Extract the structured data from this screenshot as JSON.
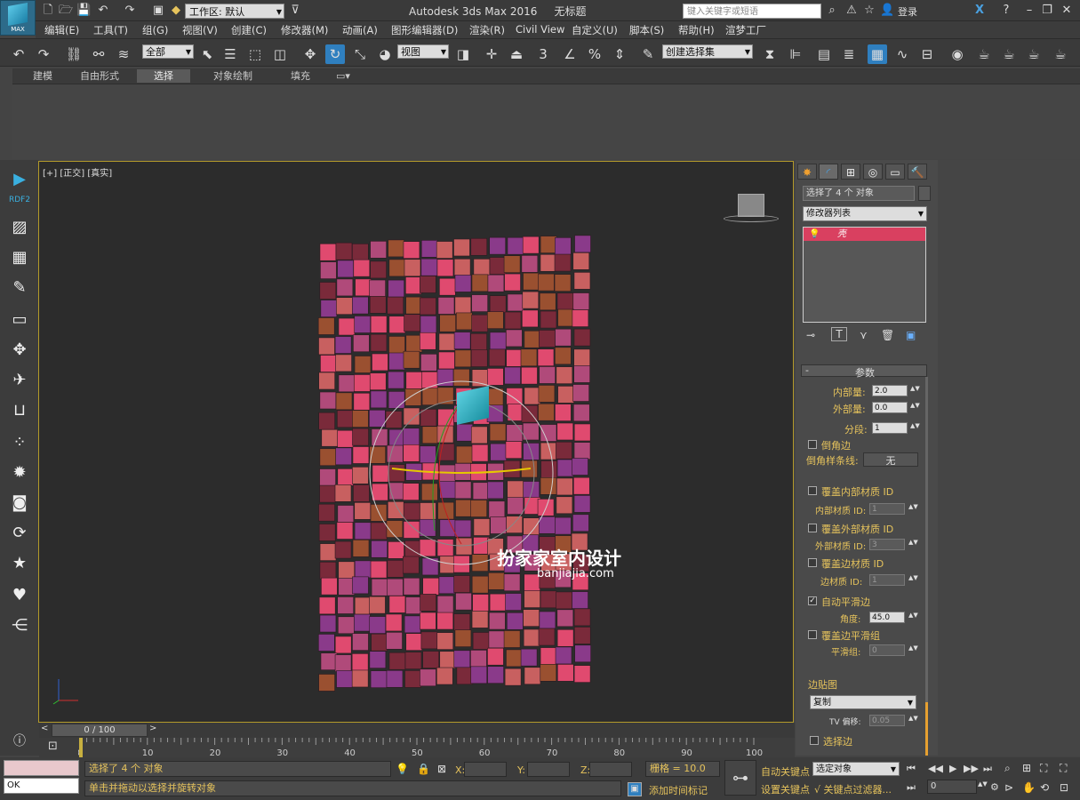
{
  "titlebar": {
    "max_label": "MAX",
    "workspace": "工作区: 默认",
    "app_title": "Autodesk 3ds Max 2016",
    "doc_title": "无标题",
    "search_placeholder": "键入关键字或短语",
    "login": "登录"
  },
  "menu": [
    "编辑(E)",
    "工具(T)",
    "组(G)",
    "视图(V)",
    "创建(C)",
    "修改器(M)",
    "动画(A)",
    "图形编辑器(D)",
    "渲染(R)",
    "Civil View",
    "自定义(U)",
    "脚本(S)",
    "帮助(H)",
    "渲梦工厂"
  ],
  "toolbar": {
    "filter": "全部",
    "refcoord": "视图",
    "selset": "创建选择集",
    "snap3": "3"
  },
  "ribbon_tabs": [
    "建模",
    "自由形式",
    "选择",
    "对象绘制",
    "填充"
  ],
  "leftbar": {
    "plugin_label": "RDF2"
  },
  "viewport": {
    "label": "[+] [正交] [真实]",
    "watermark_cn": "扮家家室内设计",
    "watermark_en": "banjiajia.com",
    "colors": [
      "#e04a6f",
      "#8a3a8a",
      "#9a5030",
      "#7a2a3a",
      "#b04a7a",
      "#c86060"
    ]
  },
  "cmdpanel": {
    "selection": "选择了 4 个 对象",
    "modlist": "修改器列表",
    "stack_item": "壳",
    "rollout": "参数",
    "inner": {
      "label": "内部量:",
      "value": "2.0"
    },
    "outer": {
      "label": "外部量:",
      "value": "0.0"
    },
    "segments": {
      "label": "分段:",
      "value": "1"
    },
    "bevel": "倒角边",
    "bevel_spline": {
      "label": "倒角样条线:",
      "value": "无"
    },
    "override_inner": "覆盖内部材质 ID",
    "inner_mat": {
      "label": "内部材质 ID:",
      "value": "1"
    },
    "override_outer": "覆盖外部材质 ID",
    "outer_mat": {
      "label": "外部材质 ID:",
      "value": "3"
    },
    "override_edge": "覆盖边材质 ID",
    "edge_mat": {
      "label": "边材质 ID:",
      "value": "1"
    },
    "auto_smooth": "自动平滑边",
    "angle": {
      "label": "角度:",
      "value": "45.0"
    },
    "override_smooth": "覆盖边平滑组",
    "smooth_group": {
      "label": "平滑组:",
      "value": "0"
    },
    "edge_map": "边贴图",
    "edge_map_value": "复制",
    "tv_offset": {
      "label": "TV 偏移:",
      "value": "0.05"
    },
    "select_edges": "选择边"
  },
  "timeline": {
    "frame": "0 / 100",
    "ticks": [
      "0",
      "10",
      "20",
      "30",
      "40",
      "50",
      "60",
      "70",
      "80",
      "90",
      "100"
    ]
  },
  "status": {
    "sel_msg": "选择了 4 个 对象",
    "hint": "单击并拖动以选择并旋转对象",
    "ok": "OK",
    "x": "X:",
    "y": "Y:",
    "z": "Z:",
    "grid": "栅格 = 10.0",
    "auto_key": "自动关键点",
    "set_key": "设置关键点",
    "add_time_tag": "添加时间标记",
    "sel_obj": "选定对象",
    "key_filters": "关键点过滤器...",
    "frame_field": "0"
  }
}
